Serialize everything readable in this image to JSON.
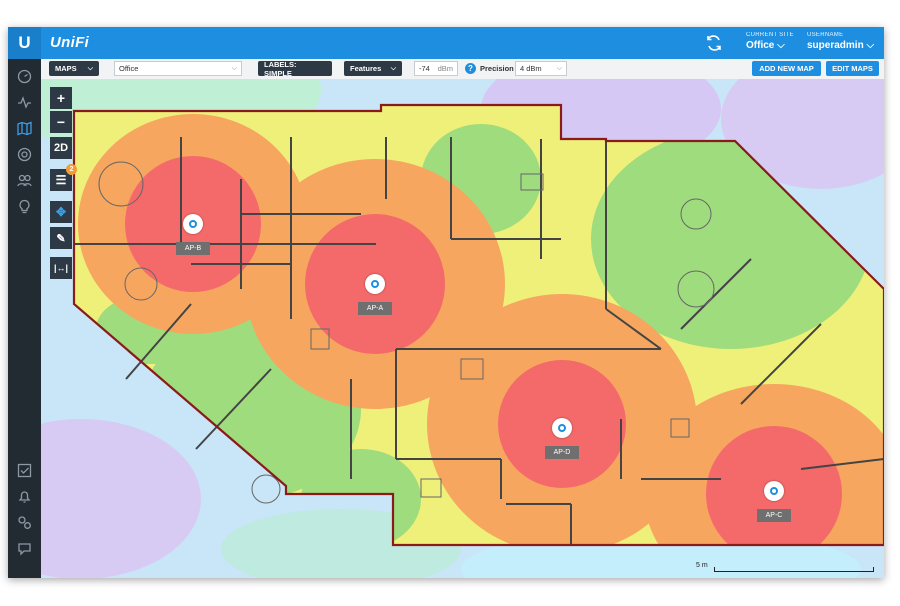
{
  "header": {
    "brand": "UniFi",
    "current_site_label": "CURRENT SITE",
    "current_site": "Office",
    "username_label": "USERNAME",
    "username": "superadmin"
  },
  "toolbar": {
    "maps_label": "MAPS",
    "map_select": "Office",
    "labels_btn": "LABELS: SIMPLE",
    "features_btn": "Features",
    "signal_value": "-74",
    "signal_unit": "dBm",
    "precision_label": "Precision",
    "precision_value": "4 dBm",
    "add_map": "ADD NEW MAP",
    "edit_maps": "EDIT MAPS"
  },
  "map_tools": {
    "zoom_in": "+",
    "zoom_out": "−",
    "view_mode": "2D",
    "list_badge": "2"
  },
  "access_points": [
    {
      "label": "AP-B"
    },
    {
      "label": "AP-A"
    },
    {
      "label": "AP-D"
    },
    {
      "label": "AP-C"
    }
  ],
  "scale": {
    "label": "5 m"
  },
  "colors": {
    "accent": "#1e8fe0",
    "sidebar": "#222a32",
    "strong": "#f46a6a",
    "good": "#f7a65f",
    "fair": "#eef07a",
    "weak": "#9fdc7d",
    "poor": "#c6b6f0"
  }
}
